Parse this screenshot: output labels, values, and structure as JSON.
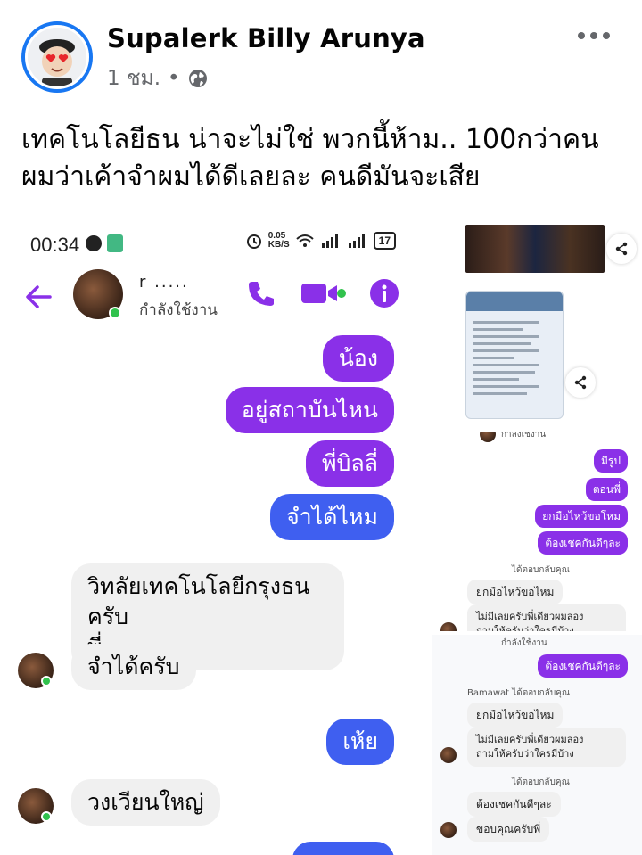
{
  "post": {
    "author": "Supalerk Billy Arunya",
    "time": "1 ชม.",
    "separator": "•",
    "privacy_icon": "globe-icon",
    "text": "เทคโนโลยีธน น่าจะไม่ใช่ พวกนี้ห้าม..  100กว่าคน\nผมว่าเค้าจำผมได้ดีเลยละ คนดีมันจะเสีย"
  },
  "left_screenshot": {
    "status_time": "00:34",
    "speed": "0.05\nKB/S",
    "battery": "17",
    "chat_name": "r     .....",
    "chat_status": "กำลังใช้งาน",
    "messages": {
      "m1": "น้อง",
      "m2": "อยู่สถาบันไหน",
      "m3": "พี่บิลลี่",
      "m4": "จำได้ไหม",
      "m5": "วิทลัยเทคโนโลยีกรุงธนครับ\nพี่",
      "m6": "จำได้ครับ",
      "m7": "เห้ย",
      "m8": "วงเวียนใหญ่"
    }
  },
  "right_screenshot_2": {
    "top_status": "กาลงเชงาน",
    "s1": "มีรูป",
    "s2": "ตอนพี่",
    "s3": "ยกมือไหว้ขอโหม",
    "s4": "ต้องเชคกันดีๆละ",
    "note": "ได้ตอบกลับคุณ",
    "r1": "ยกมือไหว้ขอไหม",
    "r2": "ไม่มีเลยครับพี่เดียวผมลอง\nถามให้ครับว่าใครมีบ้าง"
  },
  "right_screenshot_3": {
    "top_status": "กำลังใช้งาน",
    "s1": "ต้องเชคกันดีๆละ",
    "note1": "Bamawat ได้ตอบกลับคุณ",
    "r1": "ยกมือไหว้ขอไหม",
    "r2": "ไม่มีเลยครับพี่เดียวผมลอง\nถามให้ครับว่าใครมีบ้าง",
    "note2": "ได้ตอบกลับคุณ",
    "r3": "ต้องเชคกันดีๆละ",
    "r4": "ขอบคุณครับพี่"
  },
  "colors": {
    "messenger_purple": "#8a30e8",
    "messenger_blue": "#3f5ff0",
    "facebook_blue": "#1877f2",
    "online_green": "#31c24d"
  }
}
